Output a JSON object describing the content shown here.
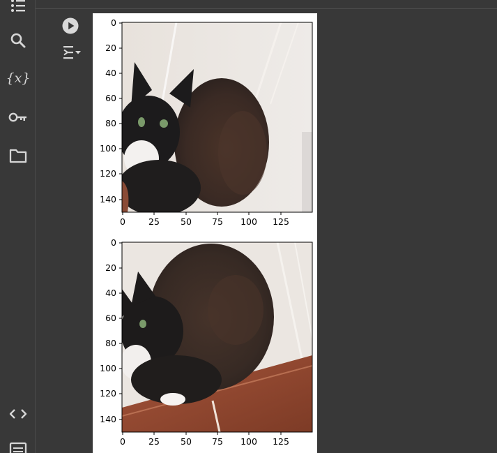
{
  "sidebar": {
    "items": [
      {
        "name": "table-of-contents",
        "icon": "list-icon"
      },
      {
        "name": "search",
        "icon": "search-icon"
      },
      {
        "name": "variables",
        "icon": "variables-icon",
        "glyph": "{x}"
      },
      {
        "name": "secrets",
        "icon": "key-icon"
      },
      {
        "name": "files",
        "icon": "folder-icon"
      },
      {
        "name": "code-snippets",
        "icon": "code-icon"
      },
      {
        "name": "command-palette",
        "icon": "terminal-icon"
      }
    ]
  },
  "cell": {
    "run_icon": "play-circle-icon",
    "output_icon": "output-menu-icon"
  },
  "plots": [
    {
      "image": "cat photo (black and white long-haired cat, upright)",
      "y_ticks": [
        "0",
        "20",
        "40",
        "60",
        "80",
        "100",
        "120",
        "140"
      ],
      "x_ticks": [
        "0",
        "25",
        "50",
        "75",
        "100",
        "125"
      ],
      "xlim": [
        0,
        150
      ],
      "ylim": [
        150,
        0
      ]
    },
    {
      "image": "cat photo (black and white long-haired cat, rotated/cropped augmentation)",
      "y_ticks": [
        "0",
        "20",
        "40",
        "60",
        "80",
        "100",
        "120",
        "140"
      ],
      "x_ticks": [
        "0",
        "25",
        "50",
        "75",
        "100",
        "125"
      ],
      "xlim": [
        0,
        150
      ],
      "ylim": [
        150,
        0
      ]
    }
  ],
  "colors": {
    "background": "#383838",
    "icon": "#d6d6d6",
    "output_background": "#ffffff"
  }
}
